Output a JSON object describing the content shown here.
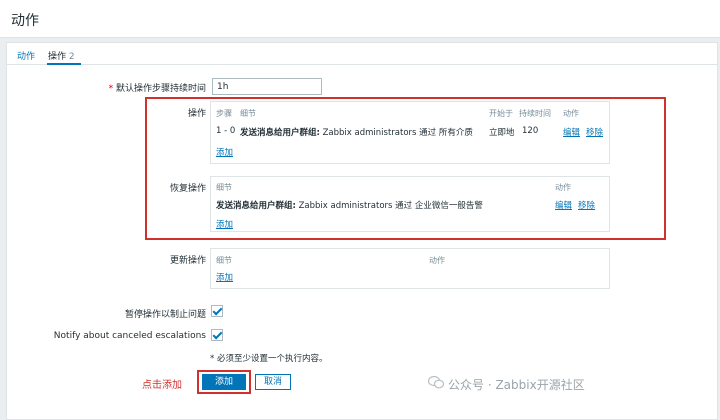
{
  "page": {
    "title": "动作"
  },
  "tabs": [
    {
      "label": "动作"
    },
    {
      "label": "操作"
    },
    {
      "count": "2"
    }
  ],
  "default_step_duration": {
    "label": "默认操作步骤持续时间",
    "value": "1h"
  },
  "operations": {
    "label": "操作",
    "headers": {
      "steps": "步骤",
      "details": "细节",
      "start_in": "开始于",
      "duration": "持续时间",
      "action": "动作"
    },
    "rows": [
      {
        "steps": "1 - 0",
        "details_bold": "发送消息给用户群组:",
        "details_rest": " Zabbix administrators 通过 所有介质",
        "start_in": "立即地",
        "duration": "120",
        "edit": "编辑",
        "remove": "移除"
      }
    ],
    "add_link": "添加"
  },
  "recovery_operations": {
    "label": "恢复操作",
    "headers": {
      "details": "细节",
      "action": "动作"
    },
    "rows": [
      {
        "details_bold": "发送消息给用户群组:",
        "details_rest": " Zabbix administrators 通过 企业微信一般告警",
        "edit": "编辑",
        "remove": "移除"
      }
    ],
    "add_link": "添加"
  },
  "update_operations": {
    "label": "更新操作",
    "headers": {
      "details": "细节",
      "action": "动作"
    },
    "add_link": "添加"
  },
  "pause_for_suppressed": {
    "label": "暂停操作以制止问题",
    "checked": true
  },
  "notify_canceled": {
    "label": "Notify about canceled escalations",
    "checked": true
  },
  "required_note": "* 必须至少设置一个执行内容。",
  "annotation": "点击添加",
  "buttons": {
    "add": "添加",
    "cancel": "取消"
  },
  "watermark": "公众号 · Zabbix开源社区",
  "colors": {
    "accent": "#0275b8",
    "highlight": "#d0312d",
    "required": "#d40000"
  }
}
